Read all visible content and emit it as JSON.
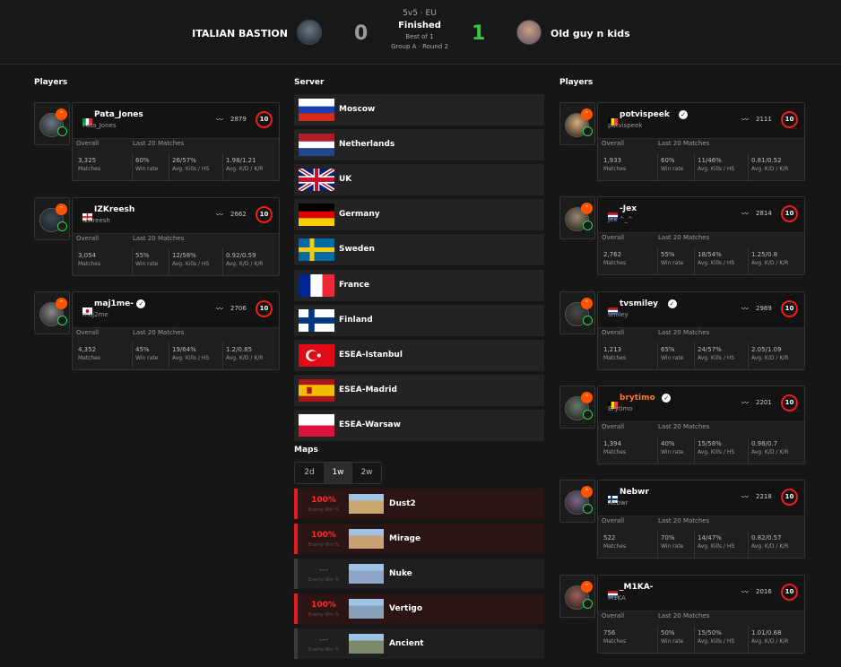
{
  "match": {
    "team1": {
      "name": "ITALIAN BASTION",
      "score": "0"
    },
    "team2": {
      "name": "Old guy n kids",
      "score": "1"
    },
    "mode": "5v5 · EU",
    "status": "Finished",
    "format": "Best of 1",
    "group": "Group A · Round 2",
    "colors": {
      "loser_score": "#9a9a9a",
      "winner_score": "#2ecc40",
      "accent": "#ff5500",
      "skill_ring": "#f01c1c",
      "verified_shield": "#32d35a"
    }
  },
  "labels": {
    "players": "Players",
    "server": "Server",
    "maps": "Maps",
    "overall": "Overall",
    "last20": "Last 20 Matches",
    "matches": "Matches",
    "win_rate": "Win rate",
    "kills_hs": "Avg. Kills / HS",
    "kd_kr": "Avg. K/D / K/R",
    "enemy_win": "Enemy Win %"
  },
  "left_players": [
    {
      "name": "Pata_Jones",
      "nick": "Pata_Jones",
      "country": "Italy",
      "elo": "2879",
      "level": "10",
      "verified": false,
      "matches": "3,325",
      "win": "60%",
      "kills": "26/57%",
      "kd": "1.98/1.21"
    },
    {
      "name": "IZKreesh",
      "nick": "IZKreesh",
      "country": "England",
      "elo": "2662",
      "level": "10",
      "verified": false,
      "matches": "3,054",
      "win": "55%",
      "kills": "12/58%",
      "kd": "0.92/0.59"
    },
    {
      "name": "maj1me-",
      "nick": "maj2me",
      "country": "Japan",
      "elo": "2706",
      "level": "10",
      "verified": true,
      "matches": "4,352",
      "win": "45%",
      "kills": "19/64%",
      "kd": "1.2/0.85"
    }
  ],
  "right_players": [
    {
      "name": "potvispeek",
      "nick": "potvispeek",
      "country": "Belgium",
      "elo": "2111",
      "level": "10",
      "verified": true,
      "matches": "1,933",
      "win": "60%",
      "kills": "11/46%",
      "kd": "0.81/0.52"
    },
    {
      "name": "-Jex",
      "nick": "Jex ^_^",
      "country": "Netherlands",
      "elo": "2814",
      "level": "10",
      "verified": false,
      "matches": "2,762",
      "win": "55%",
      "kills": "18/54%",
      "kd": "1.25/0.8"
    },
    {
      "name": "tvsmiley",
      "nick": "smiley",
      "country": "Netherlands",
      "elo": "2989",
      "level": "10",
      "verified": true,
      "matches": "1,213",
      "win": "65%",
      "kills": "24/57%",
      "kd": "2.05/1.09"
    },
    {
      "name": "brytimo",
      "nick": "Brytimo",
      "country": "Belgium",
      "elo": "2201",
      "level": "10",
      "verified": true,
      "matches": "1,394",
      "win": "40%",
      "kills": "15/58%",
      "kd": "0.98/0.7"
    },
    {
      "name": "Nebwr",
      "nick": "Nebwr",
      "country": "Finland",
      "elo": "2218",
      "level": "10",
      "verified": false,
      "matches": "522",
      "win": "70%",
      "kills": "14/47%",
      "kd": "0.82/0.57"
    },
    {
      "name": "_M1KA-",
      "nick": "M1KA",
      "country": "Netherlands",
      "elo": "2016",
      "level": "10",
      "verified": false,
      "matches": "756",
      "win": "50%",
      "kills": "15/50%",
      "kd": "1.01/0.68"
    }
  ],
  "servers": [
    {
      "name": "Moscow",
      "flag": "russia"
    },
    {
      "name": "Netherlands",
      "flag": "netherlands"
    },
    {
      "name": "UK",
      "flag": "uk"
    },
    {
      "name": "Germany",
      "flag": "germany"
    },
    {
      "name": "Sweden",
      "flag": "sweden"
    },
    {
      "name": "France",
      "flag": "france"
    },
    {
      "name": "Finland",
      "flag": "finland"
    },
    {
      "name": "ESEA-Istanbul",
      "flag": "turkey"
    },
    {
      "name": "ESEA-Madrid",
      "flag": "spain"
    },
    {
      "name": "ESEA-Warsaw",
      "flag": "poland"
    }
  ],
  "map_tabs": [
    {
      "label": "2d"
    },
    {
      "label": "1w",
      "active": true
    },
    {
      "label": "2w"
    }
  ],
  "maps": [
    {
      "name": "Dust2",
      "pct": "100%"
    },
    {
      "name": "Mirage",
      "pct": "100%"
    },
    {
      "name": "Nuke",
      "pct": "---"
    },
    {
      "name": "Vertigo",
      "pct": "100%"
    },
    {
      "name": "Ancient",
      "pct": "---"
    }
  ]
}
